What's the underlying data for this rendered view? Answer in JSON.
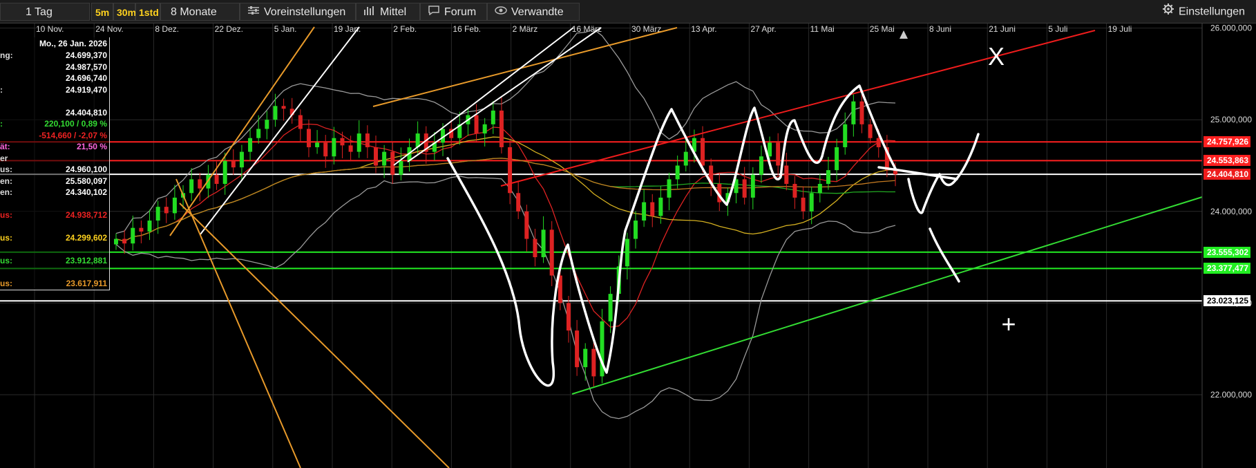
{
  "toolbar": {
    "interval": "1 Tag",
    "res_5m": "5m",
    "res_30m": "30m",
    "res_1std": "1std",
    "range": "8 Monate",
    "presets": "Voreinstellungen",
    "indicator": "Mittel",
    "forum": "Forum",
    "related": "Verwandte",
    "settings": "Einstellungen"
  },
  "info_panel": {
    "date": "Mo., 26 Jan. 2026",
    "rows": [
      {
        "label": "ng:",
        "value": "24.699,370",
        "color": "#ffffff"
      },
      {
        "label": "",
        "value": "24.987,570",
        "color": "#ffffff"
      },
      {
        "label": "",
        "value": "24.696,740",
        "color": "#ffffff"
      },
      {
        "label": ":",
        "value": "24.919,470",
        "color": "#ffffff"
      },
      {
        "label": "",
        "value": "",
        "color": "#ffffff"
      },
      {
        "label": "",
        "value": "24.404,810",
        "color": "#ffffff"
      },
      {
        "label": ":",
        "value": "220,100 / 0,89 %",
        "color": "#33dd33"
      },
      {
        "label": "",
        "value": "-514,660 / -2,07 %",
        "color": "#ee2222"
      },
      {
        "label": "ät:",
        "value": "21,50 %",
        "color": "#ff66dd"
      },
      {
        "label": "er",
        "value": "",
        "color": "#ffffff"
      },
      {
        "label": "us:",
        "value": "24.960,100",
        "color": "#ffffff"
      },
      {
        "label": "en:",
        "value": "25.580,097",
        "color": "#ffffff"
      },
      {
        "label": "en:",
        "value": "24.340,102",
        "color": "#ffffff"
      },
      {
        "label": "",
        "value": "",
        "color": "#ffffff"
      },
      {
        "label": "us:",
        "value": "24.938,712",
        "color": "#ee2222"
      },
      {
        "label": "",
        "value": "",
        "color": "#ffffff"
      },
      {
        "label": "us:",
        "value": "24.299,602",
        "color": "#ffd21e"
      },
      {
        "label": "",
        "value": "",
        "color": "#ffffff"
      },
      {
        "label": "us:",
        "value": "23.912,881",
        "color": "#33dd33"
      },
      {
        "label": "",
        "value": "",
        "color": "#ffffff"
      },
      {
        "label": "us:",
        "value": "23.617,911",
        "color": "#e89a2a"
      }
    ]
  },
  "chart_data": {
    "type": "candlestick",
    "x_ticks": [
      "10 Nov.",
      "24 Nov.",
      "8 Dez.",
      "22 Dez.",
      "5 Jan.",
      "19 Jan.",
      "2 Feb.",
      "16 Feb.",
      "2 März",
      "16 März",
      "30 März",
      "13 Apr.",
      "27 Apr.",
      "11 Mai",
      "25 Mai",
      "8 Juni",
      "21 Juni",
      "5 Juli",
      "19 Juli"
    ],
    "y_ticks": [
      {
        "value": 26000,
        "label": "26.000,000"
      },
      {
        "value": 25000,
        "label": "25.000,000"
      },
      {
        "value": 24000,
        "label": "24.000,000"
      },
      {
        "value": 23000,
        "label": "23.000,000"
      },
      {
        "value": 22000,
        "label": "22.000,000"
      }
    ],
    "ylim": [
      21200,
      26050
    ],
    "grid": true,
    "levels": [
      {
        "value": 24757.926,
        "label": "24.757,926",
        "color": "#ff2020"
      },
      {
        "value": 24553.863,
        "label": "24.553,863",
        "color": "#ff2020"
      },
      {
        "value": 24404.81,
        "label": "24.404,810",
        "color": "#ffffff"
      },
      {
        "value": 23555.302,
        "label": "23.555,302",
        "color": "#22ee22"
      },
      {
        "value": 23377.477,
        "label": "23.377,477",
        "color": "#22ee22"
      },
      {
        "value": 23023.125,
        "label": "23.023,125",
        "color": "#ffffff"
      }
    ],
    "closes": [
      23700,
      23650,
      23820,
      23780,
      23900,
      24050,
      23980,
      24150,
      24200,
      24350,
      24250,
      24400,
      24300,
      24550,
      24480,
      24650,
      24800,
      24900,
      25000,
      25150,
      25120,
      25050,
      24900,
      24700,
      24750,
      24600,
      24800,
      24720,
      24650,
      24850,
      24700,
      24500,
      24650,
      24400,
      24550,
      24700,
      24850,
      24650,
      24750,
      24900,
      24800,
      24950,
      25050,
      24850,
      24950,
      25100,
      24700,
      24200,
      24000,
      23700,
      23500,
      23800,
      23300,
      23000,
      22700,
      22300,
      22500,
      22200,
      22800,
      23100,
      23400,
      23700,
      23900,
      24100,
      23950,
      24150,
      24350,
      24500,
      24650,
      24800,
      24500,
      24300,
      24100,
      24200,
      24350,
      24150,
      24400,
      24600,
      24750,
      24500,
      24300,
      24150,
      24000,
      24200,
      24300,
      24450,
      24700,
      24950,
      25200,
      24950,
      24800,
      24700,
      24450,
      24404.81
    ],
    "annotations": [
      "X",
      "+"
    ]
  },
  "colors": {
    "bull": "#22dd22",
    "bear": "#dd2222",
    "grid": "#2a2a2a",
    "text": "#dddddd",
    "trend_red": "#ee1c1c",
    "trend_green": "#33dd33",
    "trend_orange": "#e89a2a",
    "drawing_white": "#ffffff"
  }
}
